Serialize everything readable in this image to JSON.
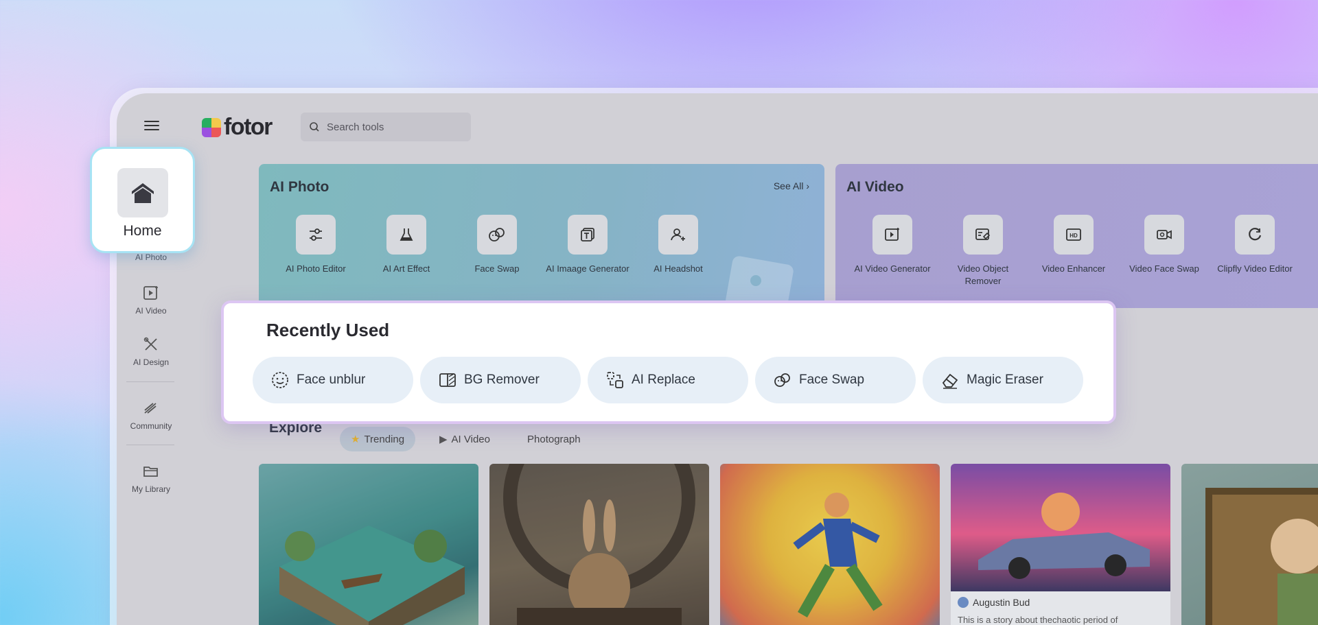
{
  "app": {
    "logo_text": "fotor",
    "search": {
      "placeholder": "Search tools"
    }
  },
  "sidebar": {
    "items": [
      {
        "label": "AI Photo"
      },
      {
        "label": "AI Video"
      },
      {
        "label": "AI Design"
      },
      {
        "label": "Community"
      },
      {
        "label": "My Library"
      }
    ]
  },
  "home_card": {
    "label": "Home"
  },
  "ai_photo": {
    "title": "AI Photo",
    "see_all": "See All",
    "tools": [
      "AI Photo Editor",
      "AI Art Effect",
      "Face Swap",
      "AI Imaage Generator",
      "AI Headshot"
    ]
  },
  "ai_video": {
    "title": "AI Video",
    "tools": [
      "AI Video Generator",
      "Video Object Remover",
      "Video Enhancer",
      "Video Face Swap",
      "Clipfly Video Editor"
    ]
  },
  "recent": {
    "title": "Recently Used",
    "items": [
      "Face unblur",
      "BG Remover",
      "AI Replace",
      "Face Swap",
      "Magic Eraser"
    ]
  },
  "explore": {
    "title": "Explore",
    "tabs": [
      "Trending",
      "AI Video",
      "Photograph"
    ],
    "cards": [
      {
        "author": "",
        "caption": ""
      },
      {
        "author": "",
        "caption": ""
      },
      {
        "author": "",
        "caption": ""
      },
      {
        "author": "Augustin Bud",
        "caption": "This is a story about thechaotic period of"
      },
      {
        "author": "",
        "caption": ""
      }
    ]
  },
  "colors": {
    "ai_photo_card": "#82b6c2",
    "ai_video_card": "#a8a0d2",
    "recent_border": "#dcc6f2",
    "home_border": "#a7e3f4"
  }
}
